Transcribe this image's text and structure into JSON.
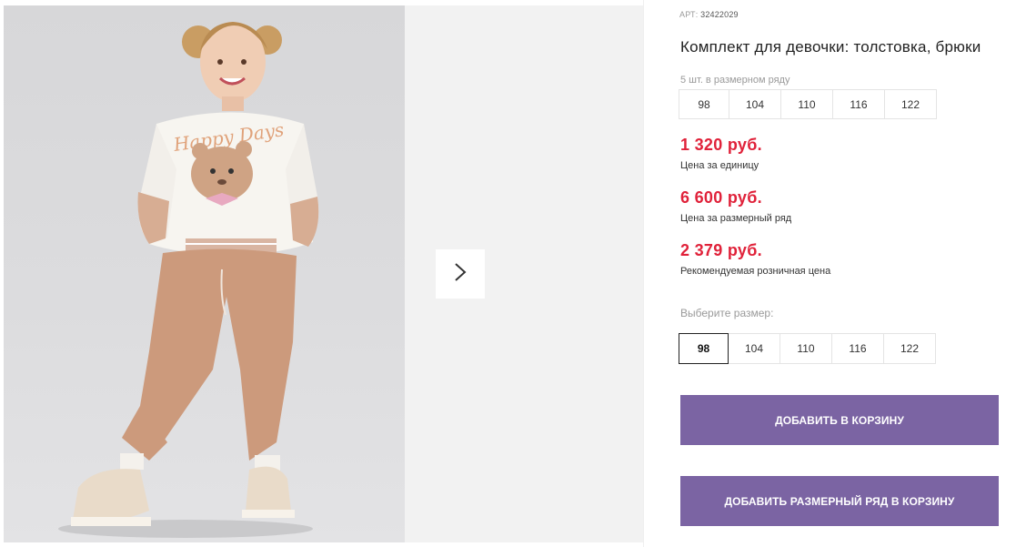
{
  "product": {
    "sku_label": "АРТ:",
    "sku_value": "32422029",
    "title": "Комплект для девочки: толстовка, брюки",
    "pack_label": "5 шт. в размерном ряду",
    "pack_sizes": [
      "98",
      "104",
      "110",
      "116",
      "122"
    ],
    "prices": [
      {
        "value": "1 320 руб.",
        "note": "Цена за единицу"
      },
      {
        "value": "6 600 руб.",
        "note": "Цена за размерный ряд"
      },
      {
        "value": "2 379 руб.",
        "note": "Рекомендуемая розничная цена"
      }
    ],
    "choose_size_label": "Выберите размер:",
    "sizes": [
      "98",
      "104",
      "110",
      "116",
      "122"
    ],
    "selected_size": "98"
  },
  "actions": {
    "add_to_cart": "ДОБАВИТЬ В КОРЗИНУ",
    "add_pack_to_cart": "ДОБАВИТЬ РАЗМЕРНЫЙ РЯД В КОРЗИНУ"
  },
  "gallery": {
    "next_icon": "chevron-right-icon",
    "photo_print_text": "Happy Days"
  },
  "colors": {
    "price": "#e0223a",
    "button": "#7b64a3"
  }
}
